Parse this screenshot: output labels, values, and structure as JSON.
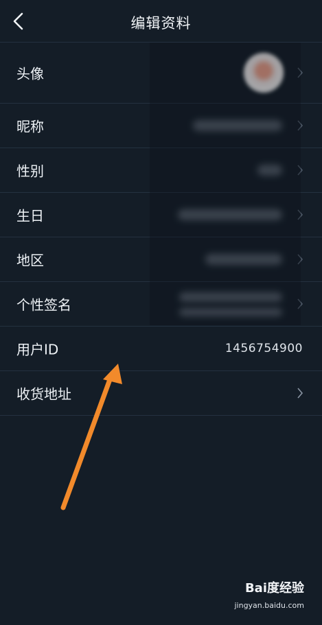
{
  "header": {
    "title": "编辑资料",
    "back_icon": "chevron-left-icon"
  },
  "rows": [
    {
      "key": "avatar",
      "label": "头像"
    },
    {
      "key": "nickname",
      "label": "昵称"
    },
    {
      "key": "gender",
      "label": "性别"
    },
    {
      "key": "birthday",
      "label": "生日"
    },
    {
      "key": "region",
      "label": "地区"
    },
    {
      "key": "signature",
      "label": "个性签名"
    },
    {
      "key": "user_id",
      "label": "用户ID",
      "value": "1456754900"
    },
    {
      "key": "shipping_address",
      "label": "收货地址"
    }
  ],
  "annotation": {
    "arrow_color": "#f28a2b"
  },
  "watermark": {
    "logo": "Bai度经验",
    "url": "jingyan.baidu.com"
  }
}
